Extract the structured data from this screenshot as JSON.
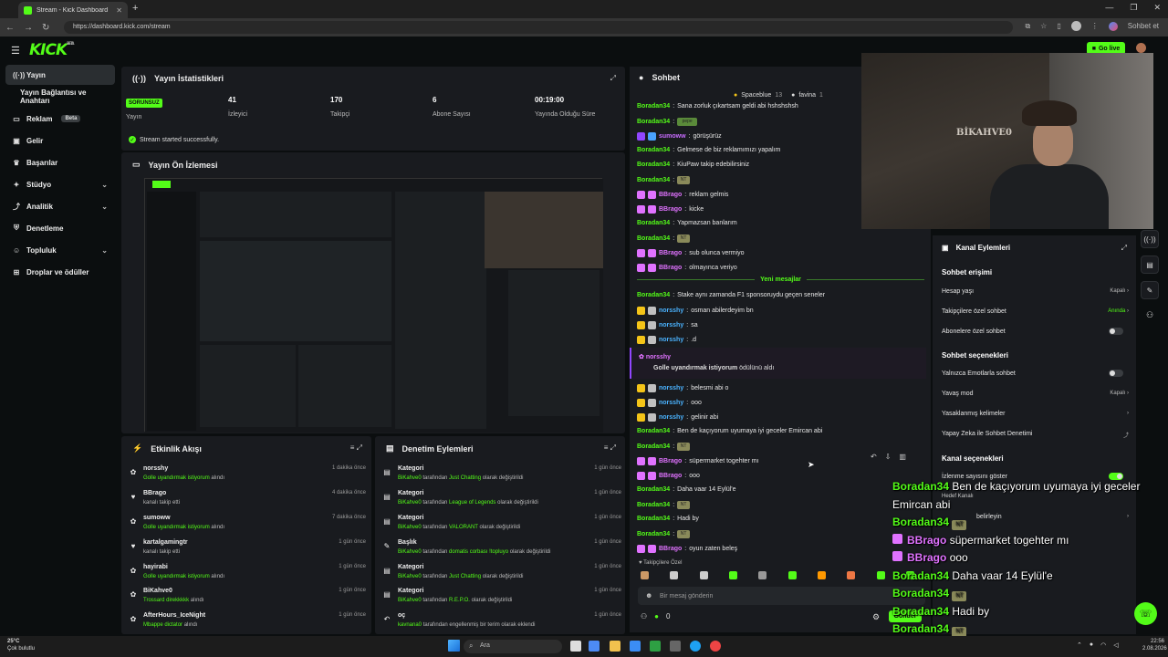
{
  "browser": {
    "tab_title": "Stream - Kick Dashboard",
    "url": "https://dashboard.kick.com/stream",
    "profile_label": "Sohbet et"
  },
  "header": {
    "logo": "KICK",
    "logo_sup": "BETA",
    "go_live": "Go live"
  },
  "sidebar": {
    "items": [
      {
        "label": "Yayın",
        "icon": "broadcast-icon"
      },
      {
        "label": "Yayın Bağlantısı ve Anahtarı",
        "icon": ""
      },
      {
        "label": "Reklam",
        "icon": "monitor-icon",
        "badge": "Beta"
      },
      {
        "label": "Gelir",
        "icon": "money-icon"
      },
      {
        "label": "Başarılar",
        "icon": "trophy-icon"
      },
      {
        "label": "Stüdyo",
        "icon": "studio-icon"
      },
      {
        "label": "Analitik",
        "icon": "analytics-icon"
      },
      {
        "label": "Denetleme",
        "icon": "shield-icon"
      },
      {
        "label": "Topluluk",
        "icon": "community-icon"
      },
      {
        "label": "Droplar ve ödüller",
        "icon": "gift-icon"
      }
    ]
  },
  "stats": {
    "title": "Yayın İstatistikleri",
    "status": "SORUNSUZ",
    "status_label": "Yayın",
    "viewers": "41",
    "viewers_label": "İzleyici",
    "followers": "170",
    "followers_label": "Takipçi",
    "subs": "6",
    "subs_label": "Abone Sayısı",
    "uptime": "00:19:00",
    "uptime_label": "Yayında Olduğu Süre",
    "success": "Stream started successfully."
  },
  "preview": {
    "title": "Yayın Ön İzlemesi"
  },
  "activity": {
    "title": "Etkinlik Akışı",
    "items": [
      {
        "name": "norsshy",
        "desc_hl": "Golle uyandırmak istiyorum",
        "desc": " alındı",
        "time": "1 dakika önce"
      },
      {
        "name": "BBrago",
        "desc_hl": "",
        "desc": "kanalı takip etti",
        "time": "4 dakika önce"
      },
      {
        "name": "sumoww",
        "desc_hl": "Golle uyandırmak istiyorum",
        "desc": " alındı",
        "time": "7 dakika önce"
      },
      {
        "name": "kartalgamingtr",
        "desc_hl": "",
        "desc": "kanalı takip etti",
        "time": "1 gün önce"
      },
      {
        "name": "hayirabi",
        "desc_hl": "Golle uyandırmak istiyorum",
        "desc": " alındı",
        "time": "1 gün önce"
      },
      {
        "name": "BiKahve0",
        "desc_hl": "Trossard direkkkkk",
        "desc": " alındı",
        "time": "1 gün önce"
      },
      {
        "name": "AfterHours_IceNight",
        "desc_hl": "Mbappe dictator",
        "desc": " alındı",
        "time": "1 gün önce"
      }
    ]
  },
  "moderation": {
    "title": "Denetim Eylemleri",
    "items": [
      {
        "name": "Kategori",
        "user": "BiKahve0",
        "mid": " tarafından ",
        "val": "Just Chatting",
        "end": " olarak değiştirildi",
        "time": "1 gün önce"
      },
      {
        "name": "Kategori",
        "user": "BiKahve0",
        "mid": " tarafından ",
        "val": "League of Legends",
        "end": " olarak değiştirildi",
        "time": "1 gün önce"
      },
      {
        "name": "Kategori",
        "user": "BiKahve0",
        "mid": " tarafından ",
        "val": "VALORANT",
        "end": " olarak değiştirildi",
        "time": "1 gün önce"
      },
      {
        "name": "Başlık",
        "user": "BiKahve0",
        "mid": " tarafından ",
        "val": "domatis corbası !topluyo",
        "end": " olarak değiştirildi",
        "time": "1 gün önce"
      },
      {
        "name": "Kategori",
        "user": "BiKahve0",
        "mid": " tarafından ",
        "val": "Just Chatting",
        "end": " olarak değiştirildi",
        "time": "1 gün önce"
      },
      {
        "name": "Kategori",
        "user": "BiKahve0",
        "mid": " tarafından ",
        "val": "R.E.P.O.",
        "end": " olarak değiştirildi",
        "time": "1 gün önce"
      },
      {
        "name": "oç",
        "user": "kavnana0",
        "mid": " tarafından ",
        "val": "",
        "end": "engellenmiş bir terim olarak eklendi",
        "time": "1 gün önce"
      }
    ]
  },
  "chat": {
    "title": "Sohbet",
    "top1": "Spaceblue",
    "top1_n": "13",
    "top2": "favina",
    "top2_n": "1",
    "new_messages": "Yeni mesajlar",
    "messages": [
      {
        "user": "Boradan34",
        "color": "#53fc18",
        "text": "Sana zorluk çıkartsam geldi abi hshshshsh",
        "badges": []
      },
      {
        "user": "Boradan34",
        "color": "#53fc18",
        "text": "",
        "badges": [],
        "emote": "pepe"
      },
      {
        "user": "sumoww",
        "color": "#c86cff",
        "text": "görüşürüz",
        "badges": [
          "#9146ff",
          "#4aa3ff"
        ]
      },
      {
        "user": "Boradan34",
        "color": "#53fc18",
        "text": "Gelmese de biz reklamımızı yapalım",
        "badges": []
      },
      {
        "user": "Boradan34",
        "color": "#53fc18",
        "text": "KiuPaw takip edebilirsiniz",
        "badges": []
      },
      {
        "user": "Boradan34",
        "color": "#53fc18",
        "text": "",
        "badges": [],
        "emote": "NT"
      },
      {
        "user": "BBrago",
        "color": "#e072ff",
        "text": "reklam gelmis",
        "badges": [
          "#e072ff",
          "#e072ff"
        ]
      },
      {
        "user": "BBrago",
        "color": "#e072ff",
        "text": "kicke",
        "badges": [
          "#e072ff",
          "#e072ff"
        ]
      },
      {
        "user": "Boradan34",
        "color": "#53fc18",
        "text": "Yapmazsan banlarım",
        "badges": []
      },
      {
        "user": "Boradan34",
        "color": "#53fc18",
        "text": "",
        "badges": [],
        "emote": "NT"
      },
      {
        "user": "BBrago",
        "color": "#e072ff",
        "text": "sub olunca vermiyo",
        "badges": [
          "#e072ff",
          "#e072ff"
        ]
      },
      {
        "user": "BBrago",
        "color": "#e072ff",
        "text": "olmayınca veriyo",
        "badges": [
          "#e072ff",
          "#e072ff"
        ]
      }
    ],
    "messages2": [
      {
        "user": "Boradan34",
        "color": "#53fc18",
        "text": "Stake aynı zamanda F1 sponsoruydu geçen seneler",
        "badges": []
      },
      {
        "user": "norsshy",
        "color": "#4ab3ff",
        "text": "osman abilerdeyim bn",
        "badges": [
          "#f5c518",
          "#c0c0c0"
        ]
      },
      {
        "user": "norsshy",
        "color": "#4ab3ff",
        "text": "sa",
        "badges": [
          "#f5c518",
          "#c0c0c0"
        ]
      },
      {
        "user": "norsshy",
        "color": "#4ab3ff",
        "text": ".d",
        "badges": [
          "#f5c518",
          "#c0c0c0"
        ]
      }
    ],
    "redeem_user": "norsshy",
    "redeem_reward": "Golle uyandırmak istiyorum",
    "redeem_text": " ödülünü aldı",
    "messages3": [
      {
        "user": "norsshy",
        "color": "#4ab3ff",
        "text": "belesmi abi o",
        "badges": [
          "#f5c518",
          "#c0c0c0"
        ]
      },
      {
        "user": "norsshy",
        "color": "#4ab3ff",
        "text": "ooo",
        "badges": [
          "#f5c518",
          "#c0c0c0"
        ]
      },
      {
        "user": "norsshy",
        "color": "#4ab3ff",
        "text": "gelinir abi",
        "badges": [
          "#f5c518",
          "#c0c0c0"
        ]
      },
      {
        "user": "Boradan34",
        "color": "#53fc18",
        "text": "Ben de kaçıyorum uyumaya iyi geceler Emircan abi",
        "badges": []
      },
      {
        "user": "Boradan34",
        "color": "#53fc18",
        "text": "",
        "badges": [],
        "emote": "NT"
      },
      {
        "user": "BBrago",
        "color": "#e072ff",
        "text": "süpermarket togehter mı",
        "badges": [
          "#e072ff",
          "#e072ff"
        ]
      },
      {
        "user": "BBrago",
        "color": "#e072ff",
        "text": "ooo",
        "badges": [
          "#e072ff",
          "#e072ff"
        ]
      },
      {
        "user": "Boradan34",
        "color": "#53fc18",
        "text": "Daha vaar 14 Eylül'e",
        "badges": []
      },
      {
        "user": "Boradan34",
        "color": "#53fc18",
        "text": "",
        "badges": [],
        "emote": "NT"
      },
      {
        "user": "Boradan34",
        "color": "#53fc18",
        "text": "Hadi by",
        "badges": []
      },
      {
        "user": "Boradan34",
        "color": "#53fc18",
        "text": "",
        "badges": [],
        "emote": "NT"
      },
      {
        "user": "BBrago",
        "color": "#e072ff",
        "text": "oyun zaten beleş",
        "badges": [
          "#e072ff",
          "#e072ff"
        ]
      }
    ],
    "followers_only": "Takipçilere Özel",
    "input_placeholder": "Bir mesaj gönderin",
    "points": "0",
    "send": "Gönder"
  },
  "kanal": {
    "title": "Kanal Eylemleri",
    "sec1": "Sohbet erişimi",
    "hesap": "Hesap yaşı",
    "hesap_v": "Kapalı",
    "takipci": "Takipçilere özel sohbet",
    "takipci_v": "Anında",
    "abone": "Abonelere özel sohbet",
    "sec2": "Sohbet seçenekleri",
    "emote": "Yalnızca Emotlarla sohbet",
    "yavas": "Yavaş mod",
    "yavas_v": "Kapalı",
    "yasak": "Yasaklanmış kelimeler",
    "yapay": "Yapay Zeka ile Sohbet Denetimi",
    "sec3": "Kanal seçenekleri",
    "izlenme": "İzlenme sayısını göster",
    "hedef": "Hedef Kanalı",
    "belirle": "belirleyin"
  },
  "overlay": [
    {
      "user": "Boradan34",
      "color": "#53fc18",
      "text": "Ben de kaçıyorum uyumaya iyi geceler"
    },
    {
      "user": "",
      "color": "#fff",
      "text": "Emircan abi"
    },
    {
      "user": "Boradan34",
      "color": "#53fc18",
      "text": "",
      "emote": "NT"
    },
    {
      "user": "BBrago",
      "color": "#e072ff",
      "text": "süpermarket togehter mı"
    },
    {
      "user": "BBrago",
      "color": "#e072ff",
      "text": "ooo"
    },
    {
      "user": "Boradan34",
      "color": "#53fc18",
      "text": "Daha vaar 14 Eylül'e"
    },
    {
      "user": "Boradan34",
      "color": "#53fc18",
      "text": "",
      "emote": "NT"
    },
    {
      "user": "Boradan34",
      "color": "#53fc18",
      "text": "Hadi by"
    },
    {
      "user": "Boradan34",
      "color": "#53fc18",
      "text": "",
      "emote": "NT"
    },
    {
      "user": "BBrago",
      "color": "#e072ff",
      "text": "oyun zaten beleş"
    }
  ],
  "webcam": {
    "shirt_text": "BİKAHVE0"
  },
  "taskbar": {
    "temp": "25°C",
    "weather": "Çok bulutlu",
    "search": "Ara",
    "time": "22:56",
    "date": "2.08.2026"
  },
  "colors": {
    "accent": "#53fc18",
    "panel": "#191b1f",
    "bg": "#0b0e0f"
  }
}
